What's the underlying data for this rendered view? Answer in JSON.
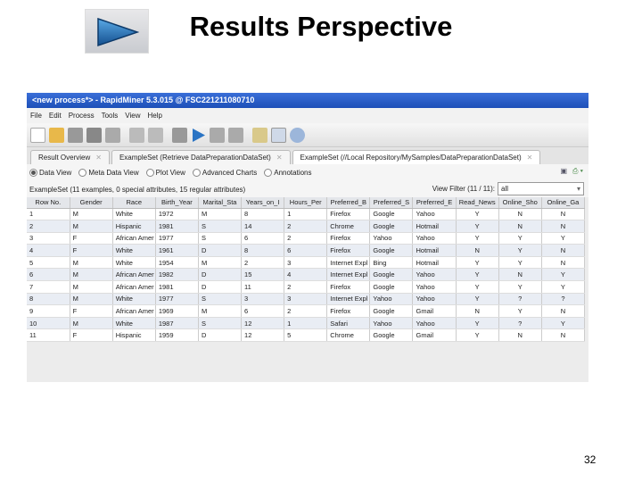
{
  "slide": {
    "title": "Results Perspective",
    "page_number": "32",
    "logo_icon": "play-arrow-icon"
  },
  "window": {
    "title": "<new process*> - RapidMiner 5.3.015 @ FSC221211080710"
  },
  "menu": [
    "File",
    "Edit",
    "Process",
    "Tools",
    "View",
    "Help"
  ],
  "tabs": [
    {
      "label": "Result Overview"
    },
    {
      "label": "ExampleSet (Retrieve DataPreparationDataSet)"
    },
    {
      "label": "ExampleSet (//Local Repository/MySamples/DataPreparationDataSet)"
    }
  ],
  "views": [
    "Data View",
    "Meta Data View",
    "Plot View",
    "Advanced Charts",
    "Annotations"
  ],
  "info": "ExampleSet (11 examples, 0 special attributes, 15 regular attributes)",
  "filter": {
    "label": "View Filter (11 / 11):",
    "value": "all"
  },
  "table": {
    "columns": [
      "Row No.",
      "Gender",
      "Race",
      "Birth_Year",
      "Marital_Sta",
      "Years_on_I",
      "Hours_Per",
      "Preferred_B",
      "Preferred_S",
      "Preferred_E",
      "Read_News",
      "Online_Sho",
      "Online_Ga"
    ],
    "rows": [
      [
        "1",
        "M",
        "White",
        "1972",
        "M",
        "8",
        "1",
        "Firefox",
        "Google",
        "Yahoo",
        "Y",
        "N",
        "N"
      ],
      [
        "2",
        "M",
        "Hispanic",
        "1981",
        "S",
        "14",
        "2",
        "Chrome",
        "Google",
        "Hotmail",
        "Y",
        "N",
        "N"
      ],
      [
        "3",
        "F",
        "African Amer",
        "1977",
        "S",
        "6",
        "2",
        "Firefox",
        "Yahoo",
        "Yahoo",
        "Y",
        "Y",
        "Y"
      ],
      [
        "4",
        "F",
        "White",
        "1961",
        "D",
        "8",
        "6",
        "Firefox",
        "Google",
        "Hotmail",
        "N",
        "Y",
        "N"
      ],
      [
        "5",
        "M",
        "White",
        "1954",
        "M",
        "2",
        "3",
        "Internet Expl",
        "Bing",
        "Hotmail",
        "Y",
        "Y",
        "N"
      ],
      [
        "6",
        "M",
        "African Amer",
        "1982",
        "D",
        "15",
        "4",
        "Internet Expl",
        "Google",
        "Yahoo",
        "Y",
        "N",
        "Y"
      ],
      [
        "7",
        "M",
        "African Amer",
        "1981",
        "D",
        "11",
        "2",
        "Firefox",
        "Google",
        "Yahoo",
        "Y",
        "Y",
        "Y"
      ],
      [
        "8",
        "M",
        "White",
        "1977",
        "S",
        "3",
        "3",
        "Internet Expl",
        "Yahoo",
        "Yahoo",
        "Y",
        "?",
        "?"
      ],
      [
        "9",
        "F",
        "African Amer",
        "1969",
        "M",
        "6",
        "2",
        "Firefox",
        "Google",
        "Gmail",
        "N",
        "Y",
        "N"
      ],
      [
        "10",
        "M",
        "White",
        "1987",
        "S",
        "12",
        "1",
        "Safari",
        "Yahoo",
        "Yahoo",
        "Y",
        "?",
        "Y"
      ],
      [
        "11",
        "F",
        "Hispanic",
        "1959",
        "D",
        "12",
        "5",
        "Chrome",
        "Google",
        "Gmail",
        "Y",
        "N",
        "N"
      ]
    ]
  }
}
